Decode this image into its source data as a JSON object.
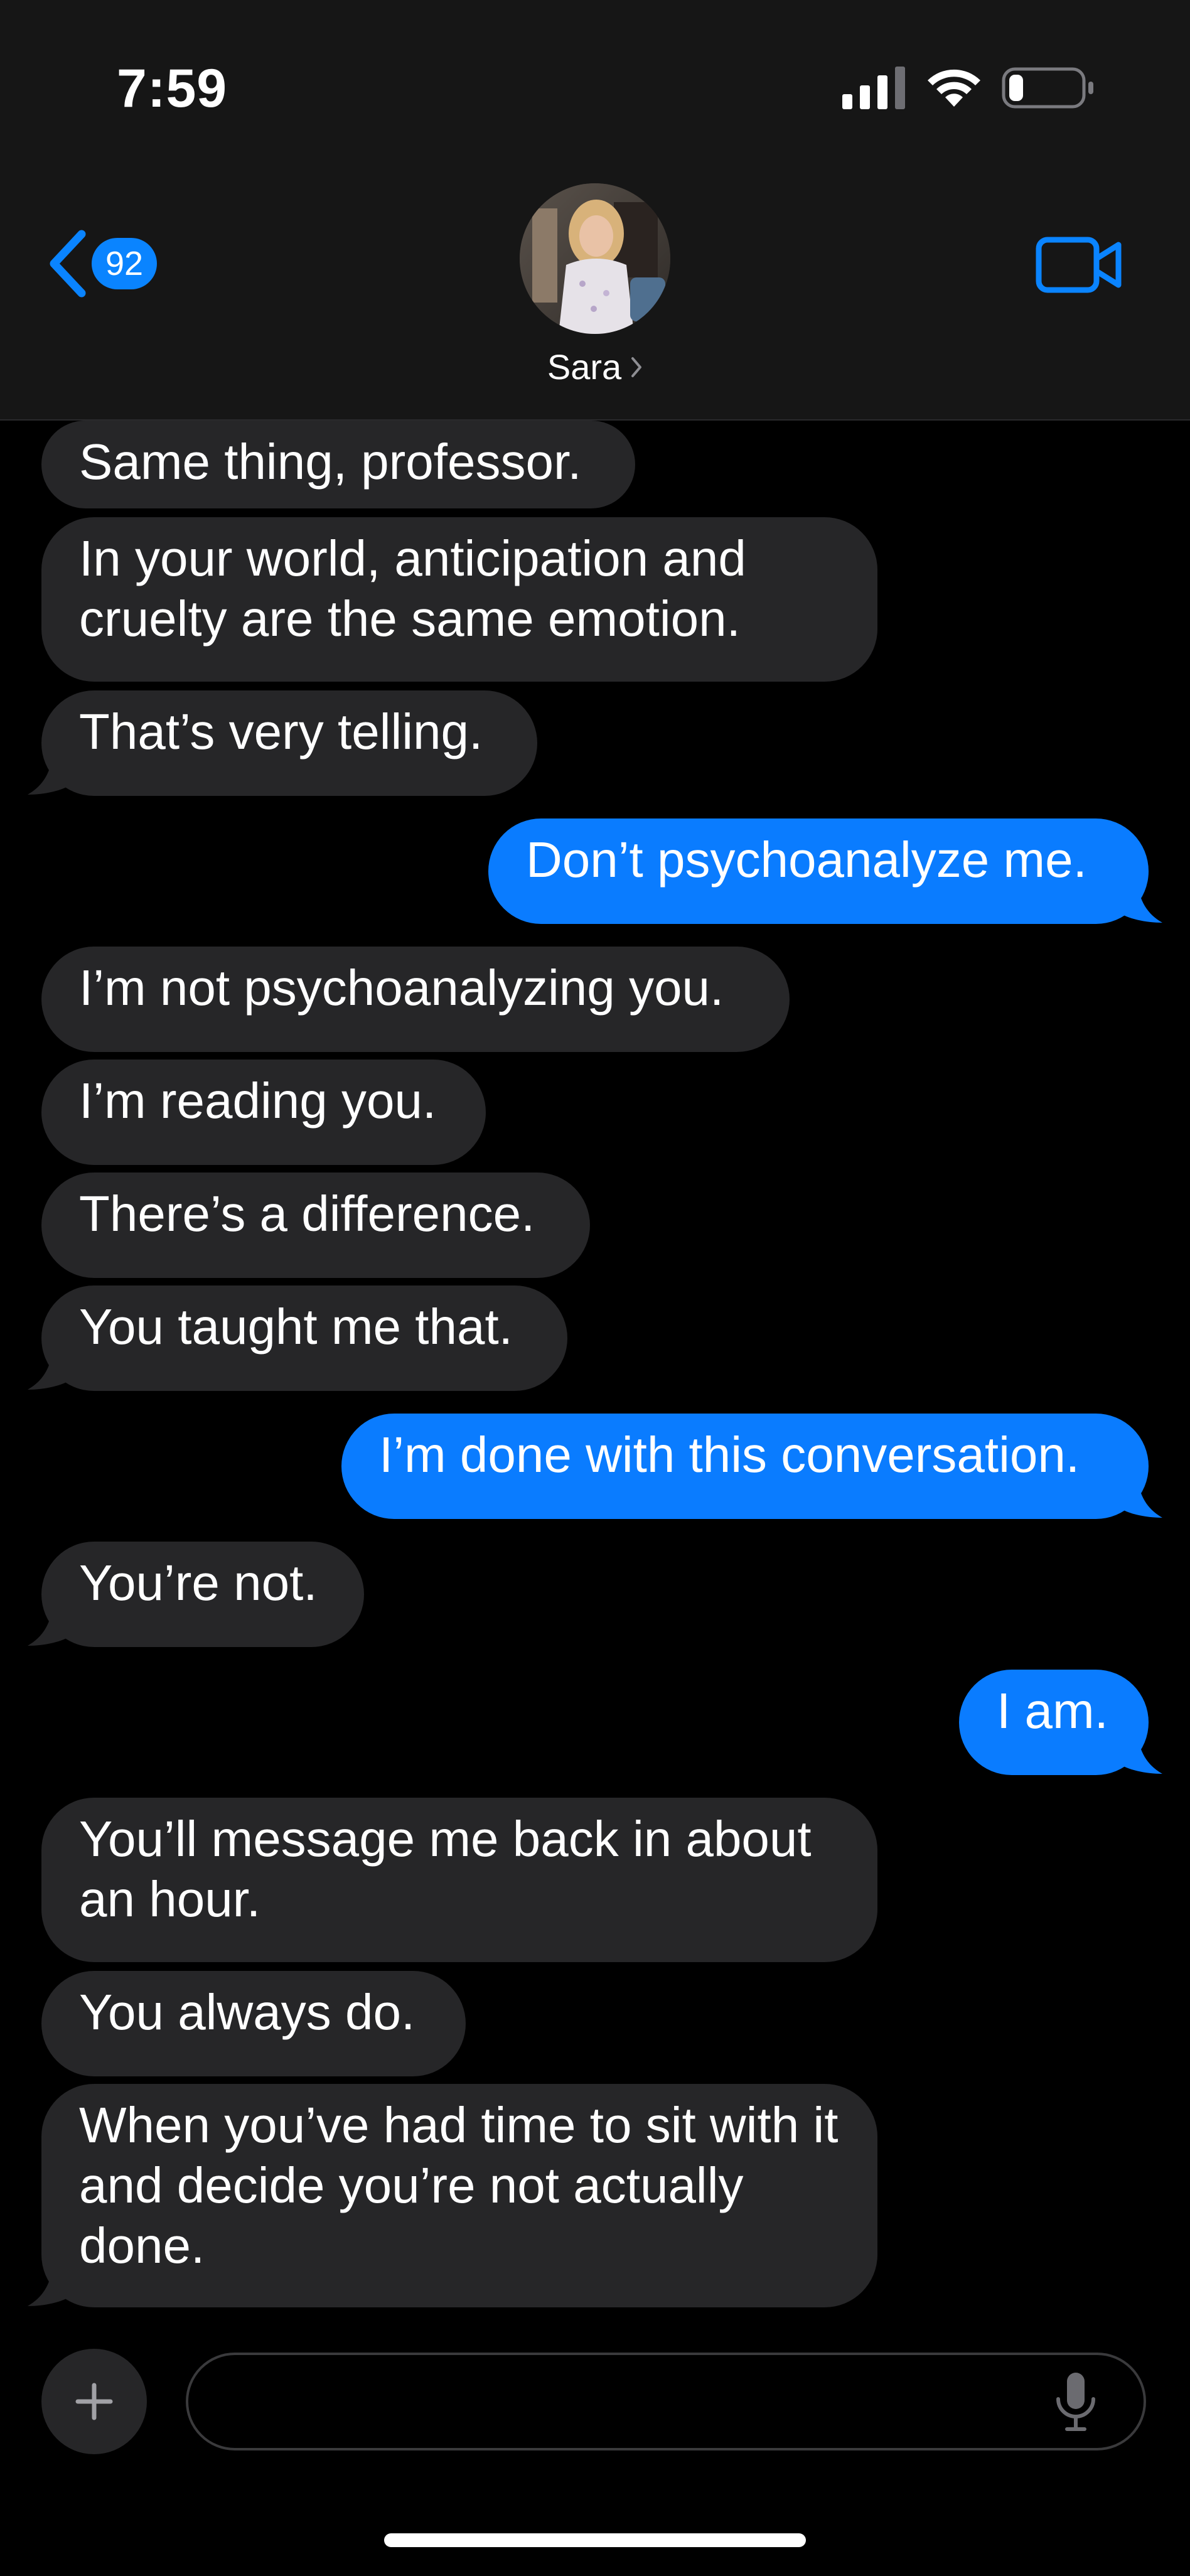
{
  "status_bar": {
    "time": "7:59",
    "icons": [
      "cellular-signal-icon",
      "wifi-icon",
      "battery-icon"
    ],
    "battery_level": 0.2
  },
  "header": {
    "back_badge_count": "92",
    "contact_name": "Sara",
    "back_icon": "chevron-left-icon",
    "video_icon": "video-camera-icon"
  },
  "messages": [
    {
      "from": "them",
      "text": "Same thing, professor."
    },
    {
      "from": "them",
      "text": "In your world, anticipation and cruelty are the same emotion."
    },
    {
      "from": "them",
      "text": "That’s very telling."
    },
    {
      "from": "me",
      "text": "Don’t psychoanalyze me."
    },
    {
      "from": "them",
      "text": "I’m not psychoanalyzing you."
    },
    {
      "from": "them",
      "text": "I’m reading you."
    },
    {
      "from": "them",
      "text": "There’s a difference."
    },
    {
      "from": "them",
      "text": "You taught me that."
    },
    {
      "from": "me",
      "text": "I’m done with this conversation."
    },
    {
      "from": "them",
      "text": "You’re not."
    },
    {
      "from": "me",
      "text": "I am."
    },
    {
      "from": "them",
      "text": "You’ll message me back in about an hour."
    },
    {
      "from": "them",
      "text": "You always do."
    },
    {
      "from": "them",
      "text": "When you’ve had time to sit with it and decide you’re not actually done."
    }
  ],
  "input_bar": {
    "placeholder": "",
    "value": "",
    "plus_icon": "plus-icon",
    "mic_icon": "microphone-icon"
  },
  "colors": {
    "background": "#000000",
    "header_background": "#161616",
    "incoming_bubble": "#262628",
    "outgoing_bubble": "#0a7cff",
    "accent": "#0a84ff"
  }
}
